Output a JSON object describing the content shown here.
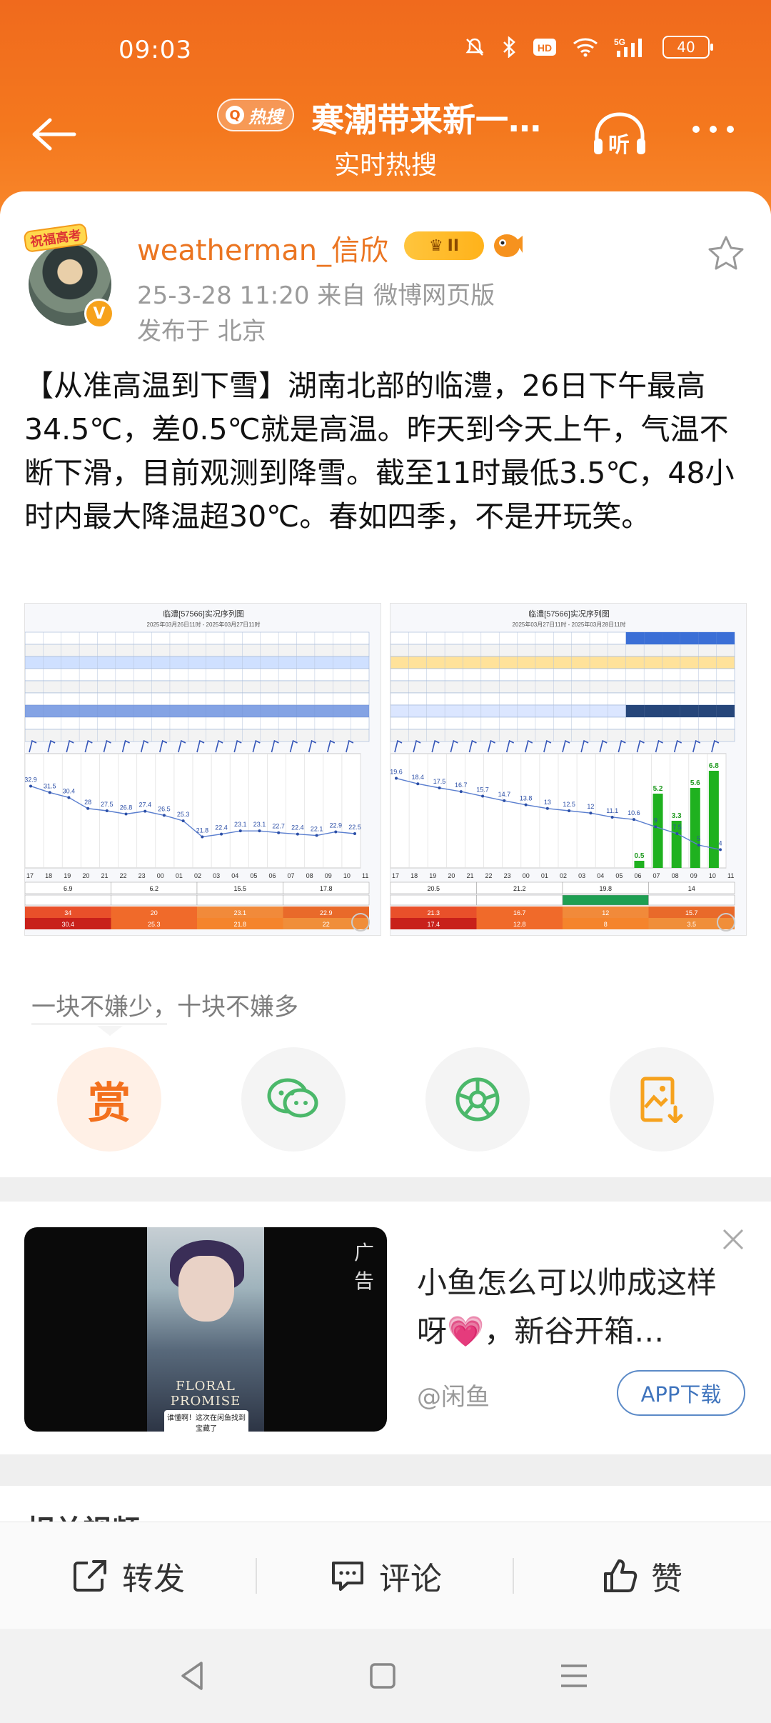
{
  "status_bar": {
    "time": "09:03",
    "battery": "40",
    "icons": [
      "mute-icon",
      "bluetooth-icon",
      "hd-icon",
      "wifi-icon",
      "5g-signal-icon",
      "battery-icon"
    ]
  },
  "nav": {
    "hot_badge": "热搜",
    "title": "寒潮带来新一…",
    "subtitle": "实时热搜",
    "listen_label": "听"
  },
  "post": {
    "avatar_tag": "祝福高考",
    "username": "weatherman_信欣",
    "vip_level": "II",
    "time_source": "25-3-28 11:20  来自 微博网页版",
    "location": "发布于 北京",
    "text": "【从准高温到下雪】湖南北部的临澧，26日下午最高34.5℃，差0.5℃就是高温。昨天到今天上午，气温不断下滑，目前观测到降雪。截至11时最低3.5℃，48小时内最大降温超30℃。春如四季，不是开玩笑。",
    "images": [
      {
        "title": "临澧[57566]实况序列图",
        "subtitle": "2025年03月26日11时 - 2025年03月27日11时",
        "temps": [
          32.9,
          31.5,
          30.4,
          28,
          27.5,
          26.8,
          27.4,
          26.5,
          25.3,
          21.8,
          22.4,
          23.1,
          23.1,
          22.7,
          22.4,
          22.1,
          22.9,
          22.5
        ],
        "hours": [
          "17",
          "18",
          "19",
          "20",
          "21",
          "22",
          "23",
          "00",
          "01",
          "02",
          "03",
          "04",
          "05",
          "06",
          "07",
          "08",
          "09",
          "10",
          "11"
        ],
        "bottom_values": [
          "6.9",
          "6.2",
          "15.5",
          "17.8"
        ],
        "hi_values": [
          "34",
          "20",
          "23.1",
          "22.9"
        ],
        "lo_values": [
          "30.4",
          "25.3",
          "21.8",
          "22"
        ]
      },
      {
        "title": "临澧[57566]实况序列图",
        "subtitle": "2025年03月27日11时 - 2025年03月28日11时",
        "temps": [
          19.6,
          18.4,
          17.5,
          16.7,
          15.7,
          14.7,
          13.8,
          13,
          12.5,
          12,
          11.1,
          10.6,
          9,
          7.5,
          5,
          4
        ],
        "precip": [
          {
            "label": "0.5",
            "v": 0.5
          },
          {
            "label": "5.2",
            "v": 5.2
          },
          {
            "label": "3.3",
            "v": 3.3
          },
          {
            "label": "5.6",
            "v": 5.6
          },
          {
            "label": "6.8",
            "v": 6.8
          }
        ],
        "hours": [
          "17",
          "18",
          "19",
          "20",
          "21",
          "22",
          "23",
          "00",
          "01",
          "02",
          "03",
          "04",
          "05",
          "06",
          "07",
          "08",
          "09",
          "10",
          "11"
        ],
        "bottom_values": [
          "20.5",
          "21.2",
          "19.8",
          "14"
        ],
        "hi_values": [
          "21.3",
          "16.7",
          "12",
          "15.7"
        ],
        "lo_values": [
          "17.4",
          "12.8",
          "8",
          "3.5"
        ]
      }
    ]
  },
  "reward_tip": "一块不嫌少，十块不嫌多",
  "share": {
    "reward_label": "赏",
    "icons": [
      "wechat-icon",
      "moments-icon",
      "save-image-icon"
    ]
  },
  "ad": {
    "label": "广告",
    "title": "小鱼怎么可以帅成这样呀💗，新谷开箱…",
    "source": "@闲鱼",
    "button": "APP下载",
    "art_text": "FLORAL PROMISE",
    "art_caption": "谁懂啊！这次在闲鱼找到宝藏了"
  },
  "related_title": "相关视频",
  "actions": {
    "repost": "转发",
    "comment": "评论",
    "like": "赞"
  }
}
